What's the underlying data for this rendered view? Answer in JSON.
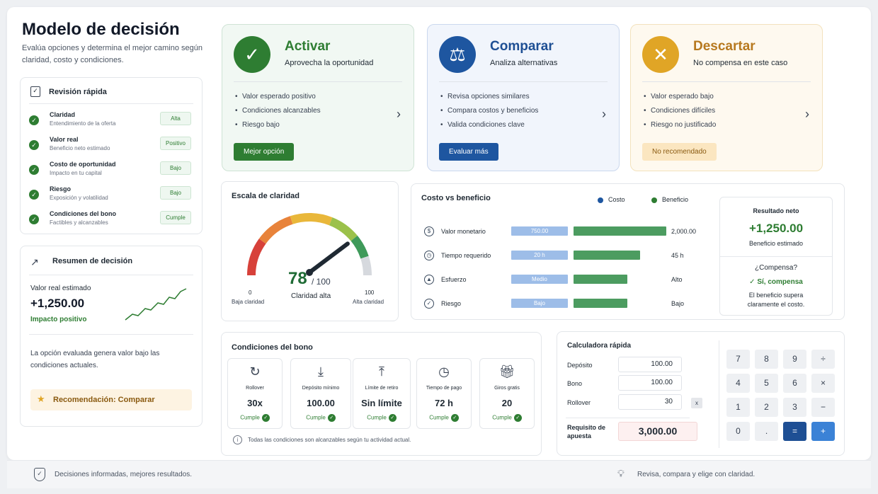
{
  "header": {
    "title": "Modelo de decisión",
    "subtitle_1": "Evalúa opciones y determina el mejor camino según",
    "subtitle_2": "claridad, costo y condiciones."
  },
  "quick_review": {
    "title": "Revisión rápida",
    "items": [
      {
        "title": "Claridad",
        "sub": "Entendimiento de la oferta",
        "badge": "Alta"
      },
      {
        "title": "Valor real",
        "sub": "Beneficio neto estimado",
        "badge": "Positivo"
      },
      {
        "title": "Costo de oportunidad",
        "sub": "Impacto en tu capital",
        "badge": "Bajo"
      },
      {
        "title": "Riesgo",
        "sub": "Exposición y volatilidad",
        "badge": "Bajo"
      },
      {
        "title": "Condiciones del bono",
        "sub": "Factibles y alcanzables",
        "badge": "Cumple"
      }
    ]
  },
  "summary": {
    "title": "Resumen de decisión",
    "label": "Valor real estimado",
    "value": "+1,250.00",
    "impact": "Impacto positivo",
    "text_1": "La opción evaluada genera valor bajo las",
    "text_2": "condiciones actuales.",
    "recommendation": "Recomendación: Comparar"
  },
  "options": [
    {
      "title": "Activar",
      "sub": "Aprovecha la oportunidad",
      "bullets": [
        "Valor esperado positivo",
        "Condiciones alcanzables",
        "Riesgo bajo"
      ],
      "button": "Mejor opción",
      "accent": "#2e7d32"
    },
    {
      "title": "Comparar",
      "sub": "Analiza alternativas",
      "bullets": [
        "Revisa opciones similares",
        "Compara costos y beneficios",
        "Valida condiciones clave"
      ],
      "button": "Evaluar más",
      "accent": "#1e56a0"
    },
    {
      "title": "Descartar",
      "sub": "No compensa en este caso",
      "bullets": [
        "Valor esperado bajo",
        "Condiciones difíciles",
        "Riesgo no justificado"
      ],
      "button": "No recomendado",
      "accent": "#e0a526"
    }
  ],
  "clarity": {
    "title": "Escala de claridad",
    "value": "78",
    "max": "/ 100",
    "label": "Claridad alta",
    "min_value": "0",
    "min_label": "Baja claridad",
    "max_value": "100",
    "max_label": "Alta claridad",
    "score": 78
  },
  "cost_benefit": {
    "title": "Costo vs beneficio",
    "legend_cost": "Costo",
    "legend_benefit": "Beneficio",
    "rows": [
      {
        "label": "Valor monetario",
        "cost": "750.00",
        "benefit": "2,000.00",
        "cost_frac": 0.54,
        "benefit_frac": 1.0
      },
      {
        "label": "Tiempo requerido",
        "cost": "20 h",
        "benefit": "45 h",
        "cost_frac": 0.54,
        "benefit_frac": 0.72
      },
      {
        "label": "Esfuerzo",
        "cost": "Medio",
        "benefit": "Alto",
        "cost_frac": 0.54,
        "benefit_frac": 0.58
      },
      {
        "label": "Riesgo",
        "cost": "Bajo",
        "benefit": "Bajo",
        "cost_frac": 0.54,
        "benefit_frac": 0.58
      }
    ]
  },
  "net": {
    "title": "Resultado neto",
    "value": "+1,250.00",
    "label": "Beneficio estimado",
    "question": "¿Compensa?",
    "answer": "Sí, compensa",
    "text_1": "El beneficio supera",
    "text_2": "claramente el costo."
  },
  "conditions": {
    "title": "Condiciones del bono",
    "ok": "Cumple",
    "items": [
      {
        "label": "Rollover",
        "value": "30x",
        "icon": "refresh-icon"
      },
      {
        "label": "Depósito mínimo",
        "value": "100.00",
        "icon": "download-icon"
      },
      {
        "label": "Límite de retiro",
        "value": "Sin límite",
        "icon": "upload-icon"
      },
      {
        "label": "Tiempo de pago",
        "value": "72 h",
        "icon": "clock-icon"
      },
      {
        "label": "Giros gratis",
        "value": "20",
        "icon": "gift-icon"
      }
    ],
    "note": "Todas las condiciones son alcanzables según tu actividad actual."
  },
  "calculator": {
    "title": "Calculadora rápida",
    "deposit_label": "Depósito",
    "deposit": "100.00",
    "bonus_label": "Bono",
    "bonus": "100.00",
    "rollover_label": "Rollover",
    "rollover": "30",
    "clear": "x",
    "result_label_1": "Requisito de",
    "result_label_2": "apuesta",
    "result": "3,000.00",
    "keys": [
      "7",
      "8",
      "9",
      "÷",
      "4",
      "5",
      "6",
      "×",
      "1",
      "2",
      "3",
      "−",
      "0",
      ".",
      "=",
      "+"
    ]
  },
  "footer": {
    "left": "Decisiones informadas, mejores resultados.",
    "right": "Revisa, compara y elige con claridad."
  }
}
